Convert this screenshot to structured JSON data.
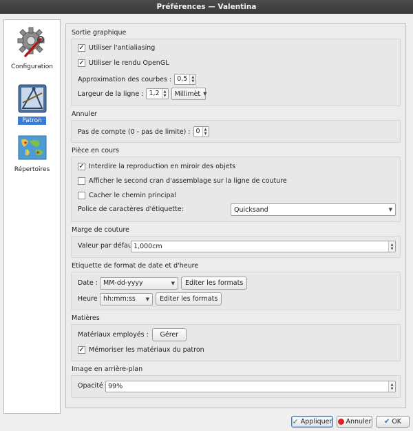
{
  "window": {
    "title": "Préférences — Valentina"
  },
  "sidebar": {
    "items": [
      {
        "label": "Configuration",
        "icon": "gear-wrench-icon",
        "selected": false
      },
      {
        "label": "Patron",
        "icon": "drafting-tools-icon",
        "selected": true
      },
      {
        "label": "Répertoires",
        "icon": "world-map-icon",
        "selected": false
      }
    ]
  },
  "graphics": {
    "title": "Sortie graphique",
    "antialiasing_label": "Utiliser l'antialiasing",
    "antialiasing_checked": true,
    "opengl_label": "Utiliser le rendu OpenGL",
    "opengl_checked": true,
    "curve_label": "Approximation des courbes :",
    "curve_value": "0,5",
    "line_width_label": "Largeur de la ligne :",
    "line_width_value": "1,2",
    "line_unit": "Millimèt"
  },
  "undo": {
    "title": "Annuler",
    "steps_label": "Pas de compte (0 - pas de limite) :",
    "steps_value": "0"
  },
  "piece": {
    "title": "Pièce en cours",
    "forbid_mirror_label": "Interdire la reproduction en miroir des objets",
    "forbid_mirror_checked": true,
    "second_notch_label": "Afficher le second cran d'assemblage sur la ligne de couture",
    "second_notch_checked": false,
    "hide_path_label": "Cacher le chemin principal",
    "hide_path_checked": false,
    "font_label": "Police de caractères d'étiquette:",
    "font_value": "Quicksand"
  },
  "seam": {
    "title": "Marge de couture",
    "default_label": "Valeur par défaut:",
    "default_value": "1,000cm"
  },
  "datetime": {
    "title": "Etiquette de format de date et d'heure",
    "date_label": "Date :",
    "date_value": "MM-dd-yyyy",
    "date_edit_button": "Editer les formats",
    "time_label": "Heure :",
    "time_value": "hh:mm:ss",
    "time_edit_button": "Editer les formats"
  },
  "materials": {
    "title": "Matières",
    "used_label": "Matériaux employés :",
    "manage_button": "Gérer",
    "remember_label": "Mémoriser les matériaux du patron",
    "remember_checked": true
  },
  "background": {
    "title": "Image en arrière-plan",
    "opacity_label": "Opacité :",
    "opacity_value": "99%"
  },
  "footer": {
    "apply_label": "Appliquer",
    "cancel_label": "Annuler",
    "ok_label": "OK"
  }
}
